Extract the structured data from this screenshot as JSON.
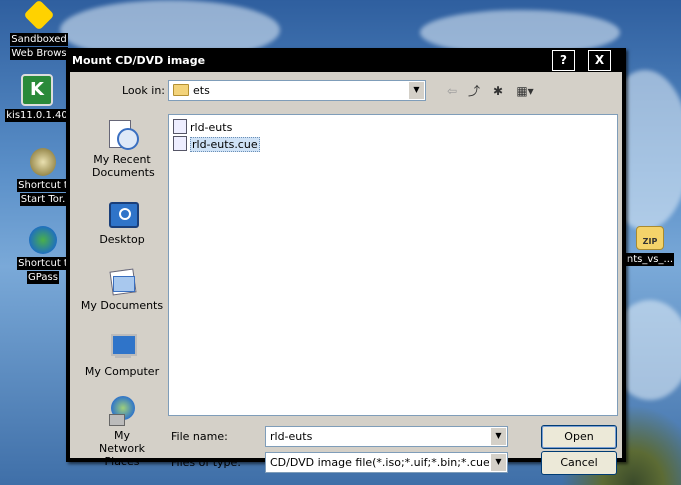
{
  "desktop": {
    "icons": [
      {
        "label_line1": "Sandboxed",
        "label_line2": "Web Brows"
      },
      {
        "label_line1": "kis11.0.1.40",
        "label_line2": ""
      },
      {
        "label_line1": "Shortcut t",
        "label_line2": "Start Tor."
      },
      {
        "label_line1": "Shortcut t",
        "label_line2": "GPass"
      },
      {
        "label_line1": "nts_vs_...",
        "label_line2": ""
      }
    ],
    "colors": {
      "sky": "#4a7fbf",
      "label_bg": "#000000"
    }
  },
  "dialog": {
    "title": "Mount CD/DVD image",
    "help_btn": "?",
    "close_btn": "X",
    "look_in_label": "Look in:",
    "look_in_value": "ets",
    "places": [
      {
        "label": "My Recent Documents",
        "icon": "recent-documents-icon"
      },
      {
        "label": "Desktop",
        "icon": "desktop-icon"
      },
      {
        "label": "My Documents",
        "icon": "my-documents-icon"
      },
      {
        "label": "My Computer",
        "icon": "my-computer-icon"
      },
      {
        "label": "My Network Places",
        "icon": "network-places-icon"
      }
    ],
    "files": [
      {
        "name": "rld-euts",
        "selected": false
      },
      {
        "name": "rld-euts.cue",
        "selected": true
      }
    ],
    "file_name_label": "File name:",
    "file_name_value": "rld-euts",
    "file_type_label": "Files of type:",
    "file_type_value": "CD/DVD image file(*.iso;*.uif;*.bin;*.cue;*.IMG;*",
    "open_btn": "Open",
    "cancel_btn": "Cancel"
  }
}
